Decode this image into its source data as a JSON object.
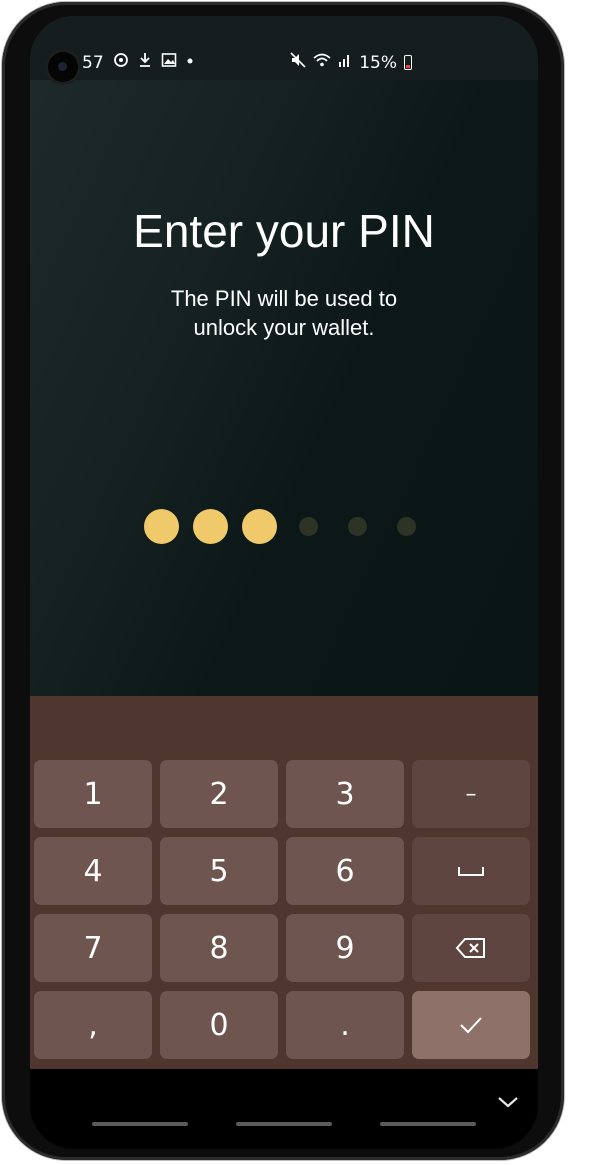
{
  "status_bar": {
    "time": "57",
    "battery_percent": "15%",
    "left_icons": [
      "sync-icon",
      "download-icon",
      "image-icon",
      "dot-icon"
    ],
    "right_icons": [
      "mute-icon",
      "wifi-icon",
      "signal-icon",
      "battery-icon"
    ]
  },
  "screen": {
    "title": "Enter your PIN",
    "subtitle": "The PIN will be used to unlock your wallet."
  },
  "pin": {
    "length": 6,
    "entered": 3,
    "filled_color": "#EFC96A",
    "empty_color": "#2E3425"
  },
  "keyboard": {
    "keys": [
      "1",
      "2",
      "3",
      "–",
      "4",
      "5",
      "6",
      "⎵",
      "7",
      "8",
      "9",
      "⌫",
      ",",
      "0",
      ".",
      "✓"
    ]
  },
  "colors": {
    "background": "#0A1616",
    "keyboard_bg": "#4F362F",
    "key": "#6F5550",
    "key_function": "#5F4540",
    "key_enter": "#8E726A"
  }
}
